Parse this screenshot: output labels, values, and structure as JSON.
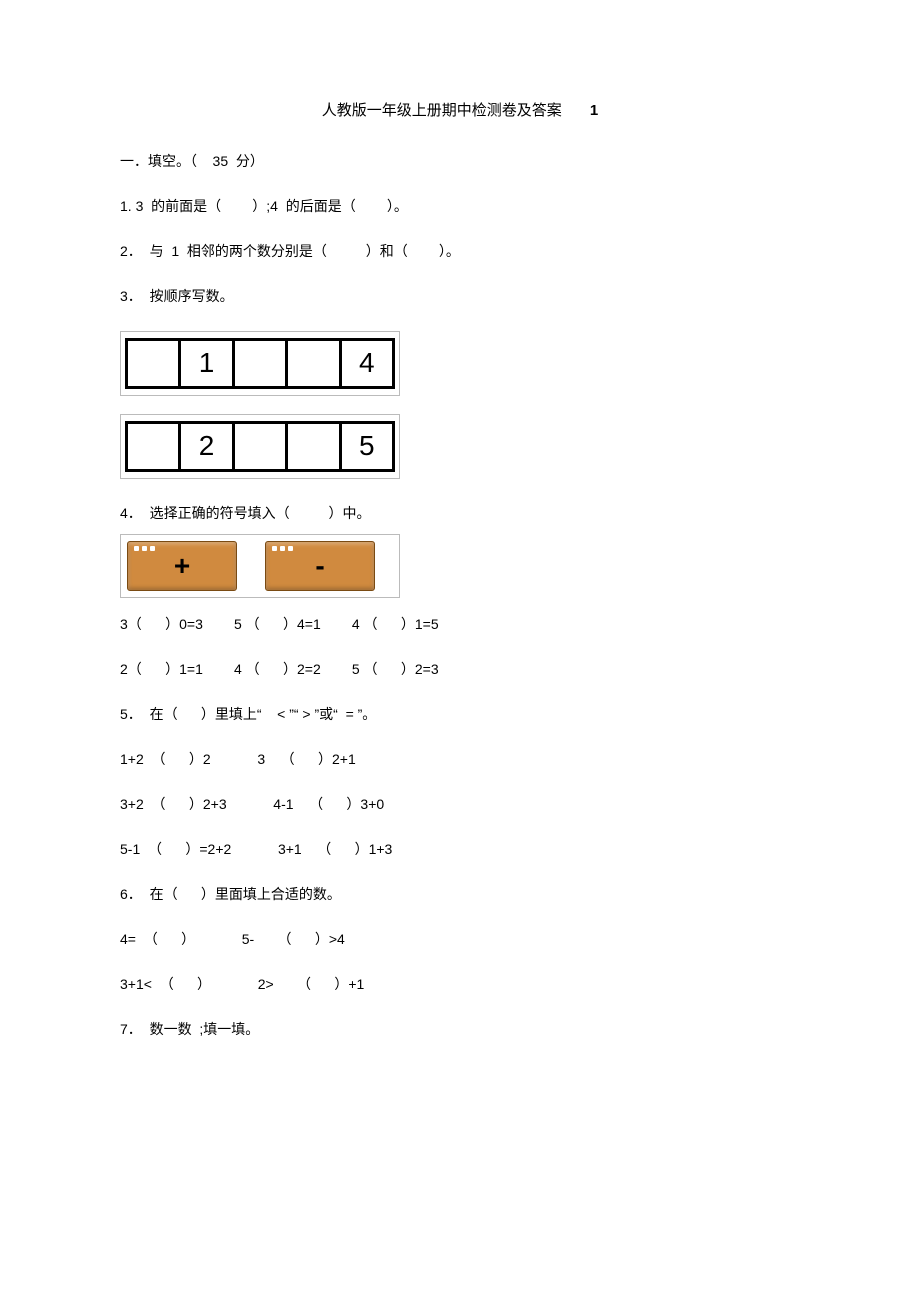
{
  "title": {
    "text": "人教版一年级上册期中检测卷及答案",
    "number": "1"
  },
  "s1": {
    "header": "一．填空。（    35  分）",
    "q1": "1. 3  的前面是（        ）;4  的后面是（        ）。",
    "q2": "2．  与  1  相邻的两个数分别是（          ）和（        ）。",
    "q3": "3．  按顺序写数。",
    "seq1": {
      "c1": "",
      "c2": "1",
      "c3": "",
      "c4": "",
      "c5": "4"
    },
    "seq2": {
      "c1": "",
      "c2": "2",
      "c3": "",
      "c4": "",
      "c5": "5"
    },
    "q4": "4．  选择正确的符号填入（          ）中。",
    "ops": {
      "plus": "+",
      "minus": "-"
    },
    "q4r1": "3（      ）0=3        5 （      ）4=1        4 （      ）1=5",
    "q4r2": "2（      ）1=1        4 （      ）2=2        5 （      ）2=3",
    "q5": "5．  在（      ）里填上“    < ”“ > ”或“  = ”。",
    "q5r1": "1+2  （      ）2            3    （      ）2+1",
    "q5r2": "3+2  （      ）2+3            4-1    （      ）3+0",
    "q5r3": "5-1  （      ）=2+2            3+1    （      ）1+3",
    "q6": "6．  在（      ）里面填上合适的数。",
    "q6r1": "4=  （      ）            5-      （      ）>4",
    "q6r2": "3+1<  （      ）            2>      （      ）+1",
    "q7": "7．  数一数  ;填一填。"
  }
}
